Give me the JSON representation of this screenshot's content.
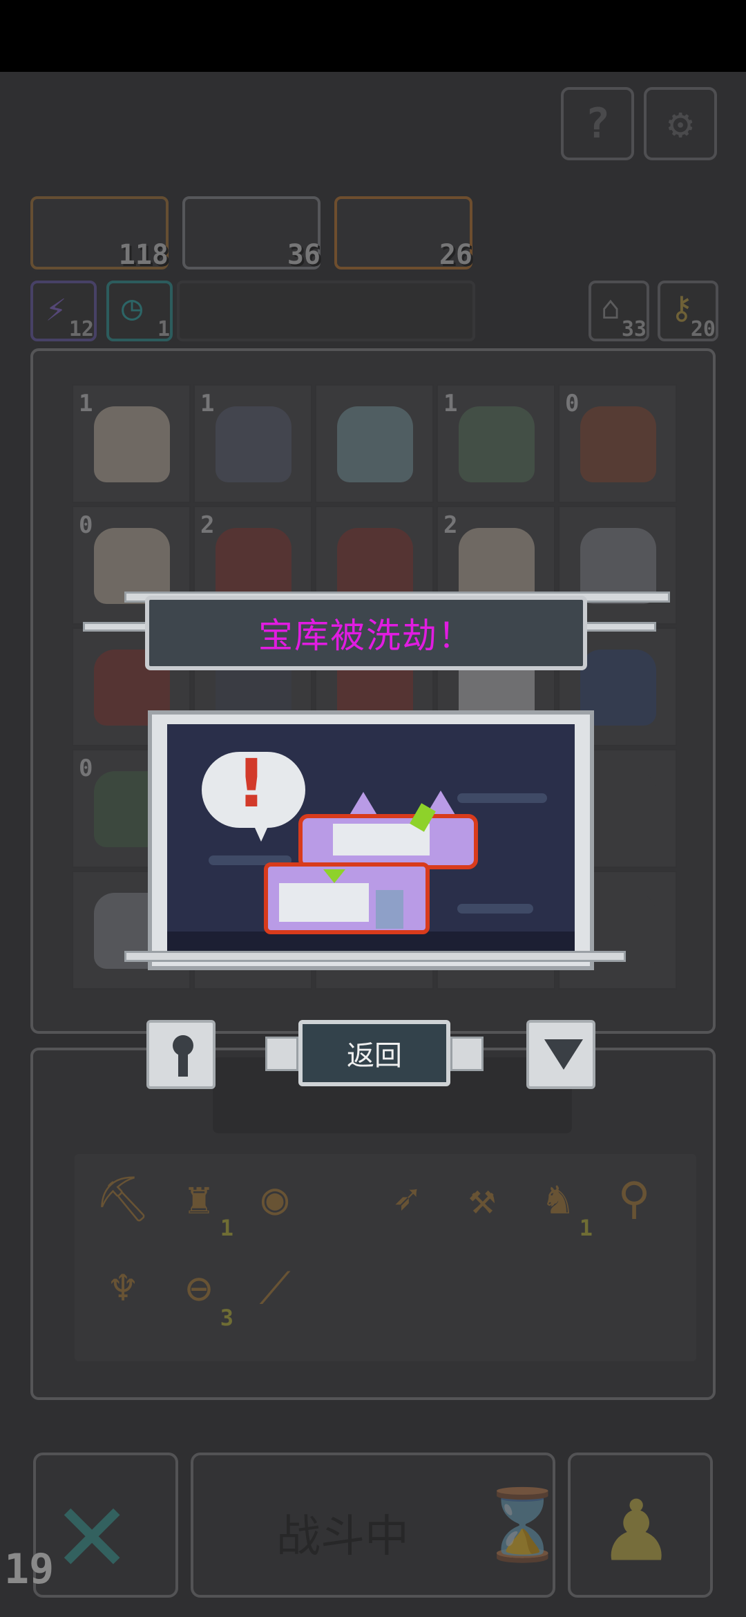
{
  "top_buttons": {
    "help_glyph": "?",
    "settings_glyph": "⚙"
  },
  "heroes": [
    {
      "count": "118",
      "border": "#b07a34"
    },
    {
      "count": "36",
      "border": "#8d8f94"
    },
    {
      "count": "26",
      "border": "#c67a2a"
    }
  ],
  "badges": {
    "energy": {
      "count": "12",
      "glyph": "⚡"
    },
    "timer": {
      "count": "1",
      "glyph": "◷"
    },
    "tickets": {
      "count": "33",
      "glyph": "⌂"
    },
    "keys": {
      "count": "20",
      "glyph": "⚷"
    }
  },
  "board": {
    "rows": [
      [
        {
          "level": "1",
          "color": "#c9b9a8"
        },
        {
          "level": "1",
          "color": "#5f6478"
        },
        {
          "level": "",
          "color": "#7fa0a6"
        },
        {
          "level": "1",
          "color": "#5f7b63"
        },
        {
          "level": "0",
          "color": "#8c4f3a"
        }
      ],
      [
        {
          "level": "0",
          "color": "#c9b9a8"
        },
        {
          "level": "2",
          "color": "#8b3d36"
        },
        {
          "level": "",
          "color": "#8b3d36"
        },
        {
          "level": "2",
          "color": "#c9b9a8"
        },
        {
          "level": "",
          "color": "#8a8d93"
        }
      ],
      [
        {
          "level": "",
          "color": "#8b3d36"
        },
        {
          "level": "",
          "color": "#4b4e5e"
        },
        {
          "level": "",
          "color": "#8b3d36"
        },
        {
          "level": "",
          "color": "#c9c9c9"
        },
        {
          "level": "",
          "color": "#3c4f7a"
        }
      ],
      [
        {
          "level": "0",
          "color": "#4f6b52"
        },
        {
          "level": "",
          "color": "#4a4a4c"
        },
        {
          "level": "",
          "color": "#4a4a4c"
        },
        {
          "level": "",
          "color": "#4a4a4c"
        },
        {
          "level": "",
          "color": "#4a4a4c"
        }
      ],
      [
        {
          "level": "",
          "color": "#8a8d93"
        },
        {
          "level": "",
          "color": "#4a4a4c"
        },
        {
          "level": "",
          "color": "#4a4a4c"
        },
        {
          "level": "",
          "color": "#4a4a4c"
        },
        {
          "level": "",
          "color": "#4a4a4c"
        }
      ]
    ]
  },
  "inventory": {
    "items": [
      {
        "glyph": "⛏",
        "count": ""
      },
      {
        "glyph": "♜",
        "count": "1"
      },
      {
        "glyph": "◉",
        "count": ""
      },
      {
        "glyph": "➶",
        "count": ""
      },
      {
        "glyph": "⚒",
        "count": ""
      },
      {
        "glyph": "♞",
        "count": "1"
      },
      {
        "glyph": "⚲",
        "count": ""
      },
      {
        "glyph": "♆",
        "count": ""
      },
      {
        "glyph": "⊖",
        "count": "3"
      },
      {
        "glyph": "⟋",
        "count": ""
      }
    ]
  },
  "modal": {
    "title": "宝库被洗劫！",
    "exclaim": "!",
    "back_label": "返回"
  },
  "bottom": {
    "close_glyph": "✕",
    "battle_label": "战斗中",
    "hourglass": "⌛",
    "pawn": "♟"
  },
  "corner_number": "19"
}
